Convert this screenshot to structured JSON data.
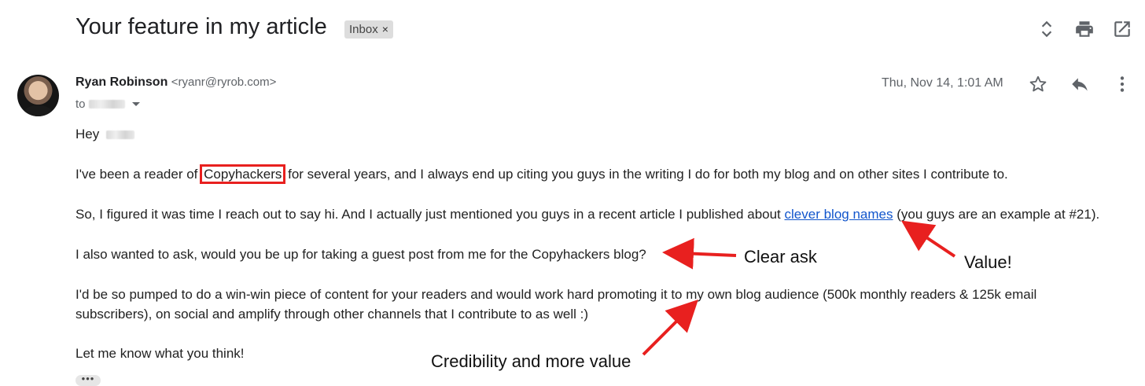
{
  "subject": "Your feature in my article",
  "label": {
    "text": "Inbox",
    "remove": "×"
  },
  "sender": {
    "name": "Ryan Robinson",
    "email": "<ryanr@ryrob.com>"
  },
  "recipient_prefix": "to",
  "date": "Thu, Nov 14, 1:01 AM",
  "body": {
    "greeting": "Hey",
    "p1_before": "I've been a reader of",
    "p1_highlight": "Copyhackers",
    "p1_after": "for several years, and I always end up citing you guys in the writing I do for both my blog and on other sites I contribute to.",
    "p2_before": "So, I figured it was time I reach out to say hi. And I actually just mentioned you guys in a recent article I published about",
    "p2_link": "clever blog names",
    "p2_after": "(you guys are an example at #21).",
    "p3": "I also wanted to ask, would you be up for taking a guest post from me for the Copyhackers blog?",
    "p4_line1": "I'd be so pumped to do a win-win piece of content for your readers and would work hard promoting it to my own blog audience (500k monthly readers & 125k email",
    "p4_line2": "subscribers), on social and amplify through other channels that I contribute to as well :)",
    "p5": "Let me know what you think!",
    "ellipsis": "•••"
  },
  "annotations": {
    "clear_ask": "Clear ask",
    "value": "Value!",
    "credibility": "Credibility and more value"
  },
  "colors": {
    "annotation_red": "#e8201f",
    "link": "#1155cc"
  },
  "icons": [
    "expand-collapse-icon",
    "print-icon",
    "open-new-window-icon",
    "star-icon",
    "reply-icon",
    "more-vert-icon",
    "dropdown-caret-icon"
  ]
}
